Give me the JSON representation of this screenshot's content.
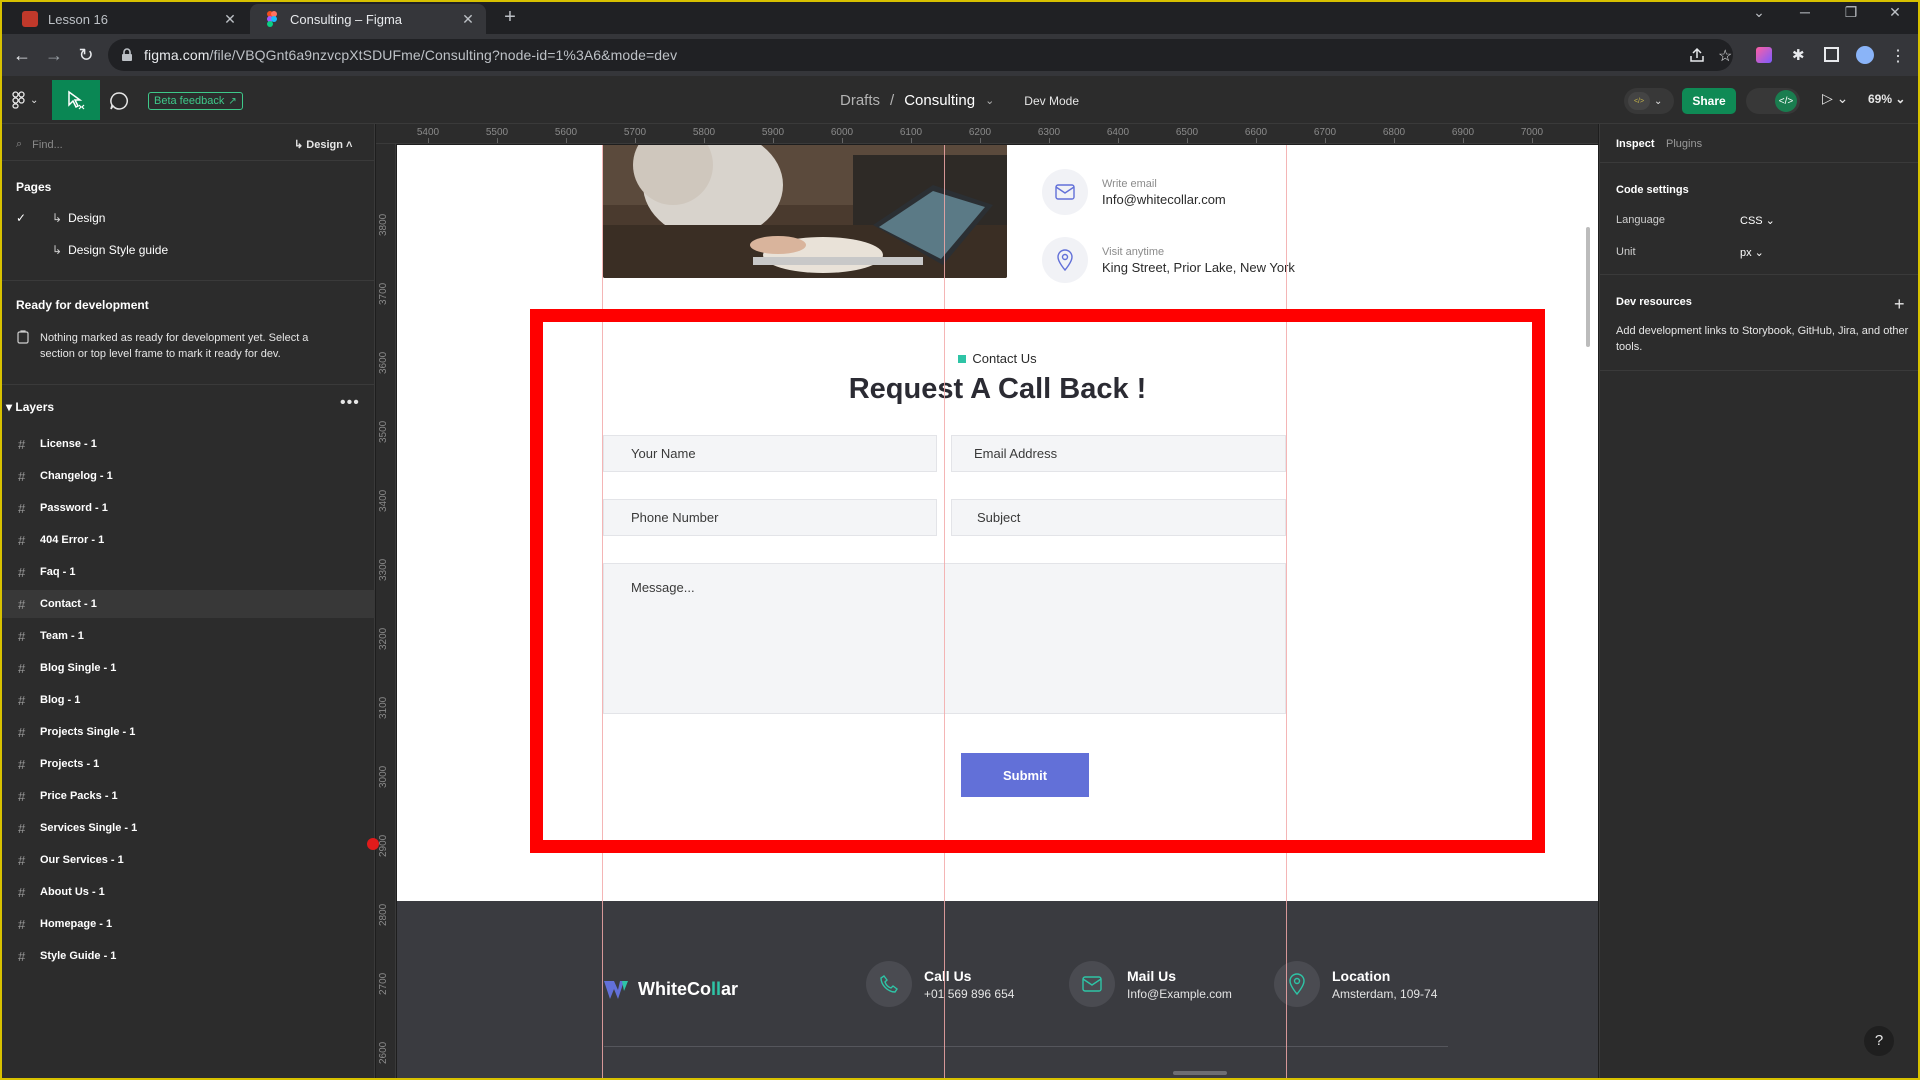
{
  "browser": {
    "tabs": [
      {
        "title": "Lesson 16",
        "active": false
      },
      {
        "title": "Consulting – Figma",
        "active": true
      }
    ],
    "new_tab": "+",
    "url_host": "figma.com",
    "url_path": "/file/VBQGnt6a9nzvcpXtSDUFme/Consulting?node-id=1%3A6&mode=dev"
  },
  "toolbar": {
    "beta_label": "Beta feedback",
    "breadcrumb_root": "Drafts",
    "breadcrumb_sep": "/",
    "breadcrumb_file": "Consulting",
    "dev_mode": "Dev Mode",
    "pill_badge": "</>",
    "share": "Share",
    "zoom": "69%"
  },
  "left": {
    "find_placeholder": "Find...",
    "design_selector": "Design",
    "pages_title": "Pages",
    "pages": [
      {
        "name": "Design",
        "checked": true
      },
      {
        "name": "Design Style guide",
        "checked": false
      }
    ],
    "ready_title": "Ready for development",
    "ready_text": "Nothing marked as ready for development yet. Select a section or top level frame to mark it ready for dev.",
    "layers_title": "Layers",
    "layers": [
      "License - 1",
      "Changelog - 1",
      "Password - 1",
      "404 Error - 1",
      "Faq - 1",
      "Contact - 1",
      "Team - 1",
      "Blog Single - 1",
      "Blog - 1",
      "Projects Single - 1",
      "Projects - 1",
      "Price Packs - 1",
      "Services Single - 1",
      "Our Services - 1",
      "About Us - 1",
      "Homepage - 1",
      "Style Guide - 1"
    ],
    "selected_layer": "Contact - 1"
  },
  "rulers": {
    "h": [
      "5400",
      "5500",
      "5600",
      "5700",
      "5800",
      "5900",
      "6000",
      "6100",
      "6200",
      "6300",
      "6400",
      "6500",
      "6600",
      "6700",
      "6800",
      "6900",
      "7000"
    ],
    "v": [
      "3800",
      "3700",
      "3600",
      "3500",
      "3400",
      "3300",
      "3200",
      "3100",
      "3000",
      "2900",
      "2800",
      "2700",
      "2600"
    ]
  },
  "design": {
    "email_label": "Write email",
    "email_value": "Info@whitecollar.com",
    "visit_label": "Visit anytime",
    "visit_value": "King Street, Prior Lake, New York",
    "eyebrow": "Contact Us",
    "title": "Request A Call Back !",
    "fields": {
      "name": "Your Name",
      "email": "Email Address",
      "phone": "Phone Number",
      "subject": "Subject",
      "message": "Message..."
    },
    "submit": "Submit",
    "footer": {
      "logo_a": "WhiteCo",
      "logo_b": "ll",
      "logo_c": "ar",
      "call_title": "Call Us",
      "call_value": "+01 569 896 654",
      "mail_title": "Mail Us",
      "mail_value": "Info@Example.com",
      "loc_title": "Location",
      "loc_value": "Amsterdam, 109-74"
    },
    "colors": {
      "highlight": "#ff0000",
      "submit": "#6270d8",
      "accent": "#2ec4a6",
      "footer": "#3a3b40"
    }
  },
  "right": {
    "tab_inspect": "Inspect",
    "tab_plugins": "Plugins",
    "code_settings": "Code settings",
    "language_label": "Language",
    "language_value": "CSS",
    "unit_label": "Unit",
    "unit_value": "px",
    "dev_resources": "Dev resources",
    "dev_resources_text": "Add development links to Storybook, GitHub, Jira, and other tools.",
    "help": "?"
  }
}
